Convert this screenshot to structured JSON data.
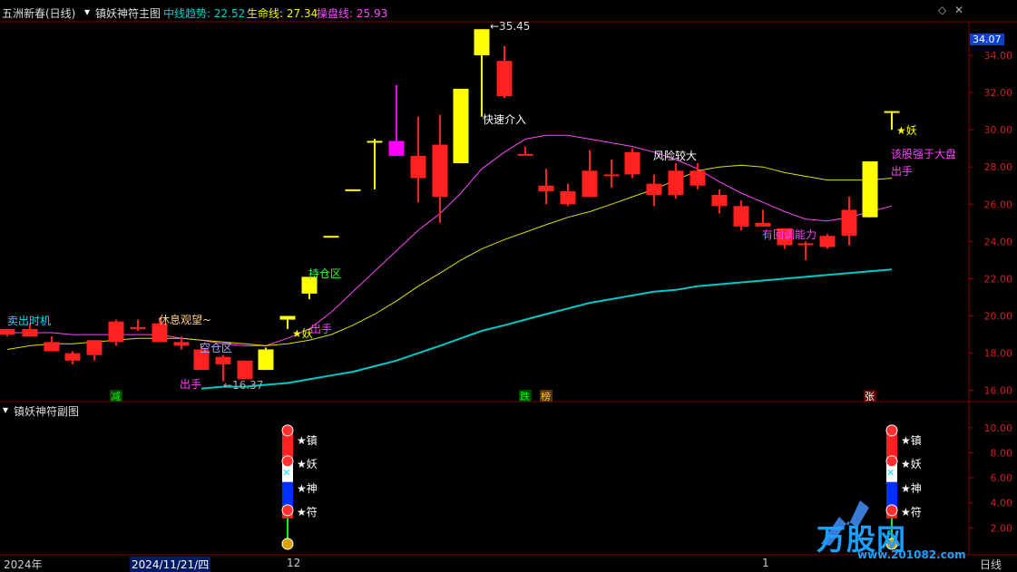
{
  "header": {
    "stock": "五洲新春(日线)",
    "indicator": "镇妖神符主图",
    "items": [
      {
        "label": "中线趋势: ",
        "value": "22.52",
        "color": "#00d0c8"
      },
      {
        "label": "生命线: ",
        "value": "27.34",
        "color": "#f5f500"
      },
      {
        "label": "操盘线: ",
        "value": "25.93",
        "color": "#ff44ff"
      }
    ]
  },
  "sub_panel": {
    "title": "镇妖神符副图"
  },
  "time_axis": {
    "left": "2024年",
    "date": "2024/11/21/四",
    "mid": "12",
    "right": "1",
    "period": "日线"
  },
  "price_flag": "34.07",
  "colors": {
    "up": "#ff2020",
    "down": "#ff2020",
    "yellow": "#ffff00",
    "magenta": "#ff00ff",
    "cyan": "#00c8c8"
  },
  "chart_data": [
    {
      "type": "candlestick",
      "title": "镇妖神符主图",
      "ylim": [
        15.4,
        35.8
      ],
      "yticks": [
        16.0,
        18.0,
        20.0,
        22.0,
        24.0,
        26.0,
        28.0,
        30.0,
        32.0,
        34.0
      ],
      "candles": [
        {
          "o": 19.0,
          "h": 19.3,
          "l": 18.9,
          "c": 19.3,
          "color": "red"
        },
        {
          "o": 19.3,
          "h": 19.6,
          "l": 18.9,
          "c": 18.9,
          "color": "red"
        },
        {
          "o": 18.6,
          "h": 18.9,
          "l": 18.1,
          "c": 18.1,
          "color": "red"
        },
        {
          "o": 18.0,
          "h": 18.1,
          "l": 17.4,
          "c": 17.6,
          "color": "red"
        },
        {
          "o": 17.9,
          "h": 18.7,
          "l": 17.6,
          "c": 18.7,
          "color": "red"
        },
        {
          "o": 18.6,
          "h": 19.8,
          "l": 18.4,
          "c": 19.7,
          "color": "red"
        },
        {
          "o": 19.3,
          "h": 19.8,
          "l": 19.2,
          "c": 19.4,
          "color": "red"
        },
        {
          "o": 18.6,
          "h": 19.9,
          "l": 18.6,
          "c": 19.6,
          "color": "red"
        },
        {
          "o": 18.6,
          "h": 18.9,
          "l": 18.2,
          "c": 18.4,
          "color": "red"
        },
        {
          "o": 18.2,
          "h": 18.4,
          "l": 17.1,
          "c": 17.1,
          "color": "red"
        },
        {
          "o": 17.8,
          "h": 17.9,
          "l": 16.5,
          "c": 17.4,
          "color": "red"
        },
        {
          "o": 17.6,
          "h": 17.6,
          "l": 16.6,
          "c": 16.6,
          "color": "red"
        },
        {
          "o": 17.1,
          "h": 18.3,
          "l": 17.1,
          "c": 18.2,
          "color": "yellow"
        },
        {
          "o": 19.8,
          "h": 20.0,
          "l": 19.3,
          "c": 20.0,
          "color": "yellow"
        },
        {
          "o": 21.2,
          "h": 22.1,
          "l": 20.9,
          "c": 22.1,
          "color": "yellow"
        },
        {
          "o": 24.3,
          "h": 24.3,
          "l": 24.3,
          "c": 24.3,
          "color": "yellow"
        },
        {
          "o": 26.8,
          "h": 26.8,
          "l": 26.8,
          "c": 26.8,
          "color": "yellow"
        },
        {
          "o": 29.4,
          "h": 29.5,
          "l": 26.8,
          "c": 29.4,
          "color": "yellow"
        },
        {
          "o": 28.6,
          "h": 32.4,
          "l": 28.6,
          "c": 29.4,
          "color": "magenta"
        },
        {
          "o": 28.6,
          "h": 30.7,
          "l": 26.1,
          "c": 27.4,
          "color": "red"
        },
        {
          "o": 29.2,
          "h": 30.8,
          "l": 25.0,
          "c": 26.4,
          "color": "red"
        },
        {
          "o": 28.2,
          "h": 32.2,
          "l": 28.2,
          "c": 32.2,
          "color": "yellow"
        },
        {
          "o": 34.0,
          "h": 35.4,
          "l": 30.7,
          "c": 35.4,
          "color": "yellow"
        },
        {
          "o": 33.7,
          "h": 34.5,
          "l": 31.7,
          "c": 31.8,
          "color": "red"
        },
        {
          "o": 28.7,
          "h": 29.1,
          "l": 28.7,
          "c": 28.7,
          "color": "red"
        },
        {
          "o": 27.0,
          "h": 27.9,
          "l": 26.0,
          "c": 26.7,
          "color": "red"
        },
        {
          "o": 26.7,
          "h": 27.1,
          "l": 25.9,
          "c": 26.0,
          "color": "red"
        },
        {
          "o": 26.4,
          "h": 28.9,
          "l": 26.4,
          "c": 27.8,
          "color": "red"
        },
        {
          "o": 27.6,
          "h": 28.4,
          "l": 26.9,
          "c": 27.6,
          "color": "red"
        },
        {
          "o": 27.6,
          "h": 29.0,
          "l": 27.4,
          "c": 28.8,
          "color": "red"
        },
        {
          "o": 27.1,
          "h": 27.6,
          "l": 25.9,
          "c": 26.5,
          "color": "red"
        },
        {
          "o": 27.8,
          "h": 28.2,
          "l": 26.3,
          "c": 26.5,
          "color": "red"
        },
        {
          "o": 27.8,
          "h": 28.2,
          "l": 26.8,
          "c": 27.0,
          "color": "red"
        },
        {
          "o": 26.5,
          "h": 26.8,
          "l": 25.5,
          "c": 25.9,
          "color": "red"
        },
        {
          "o": 25.9,
          "h": 26.2,
          "l": 24.6,
          "c": 24.8,
          "color": "red"
        },
        {
          "o": 25.0,
          "h": 25.7,
          "l": 24.8,
          "c": 24.8,
          "color": "red"
        },
        {
          "o": 24.7,
          "h": 24.7,
          "l": 23.6,
          "c": 23.8,
          "color": "red"
        },
        {
          "o": 23.9,
          "h": 24.0,
          "l": 23.0,
          "c": 23.9,
          "color": "red"
        },
        {
          "o": 24.3,
          "h": 24.4,
          "l": 23.6,
          "c": 23.7,
          "color": "red"
        },
        {
          "o": 25.7,
          "h": 26.4,
          "l": 23.8,
          "c": 24.3,
          "color": "red"
        },
        {
          "o": 25.3,
          "h": 28.3,
          "l": 25.3,
          "c": 28.3,
          "color": "yellow"
        },
        {
          "o": 31.0,
          "h": 31.0,
          "l": 30.0,
          "c": 31.0,
          "color": "yellow"
        }
      ],
      "lines": [
        {
          "name": "操盘线",
          "color": "#ff44ff",
          "values": [
            19.1,
            19.1,
            19.1,
            19.0,
            19.0,
            19.0,
            19.0,
            19.0,
            18.8,
            18.7,
            18.5,
            18.4,
            18.4,
            18.8,
            19.3,
            20.2,
            21.3,
            22.4,
            23.5,
            24.6,
            25.5,
            26.6,
            27.9,
            28.8,
            29.5,
            29.7,
            29.7,
            29.5,
            29.3,
            29.1,
            28.8,
            28.4,
            27.9,
            27.2,
            26.6,
            26.1,
            25.6,
            25.2,
            25.1,
            25.3,
            25.6,
            25.9
          ]
        },
        {
          "name": "生命线",
          "color": "#e0e000",
          "values": [
            18.2,
            18.4,
            18.5,
            18.5,
            18.6,
            18.7,
            18.8,
            18.8,
            18.8,
            18.7,
            18.6,
            18.5,
            18.4,
            18.5,
            18.7,
            19.0,
            19.5,
            20.1,
            20.8,
            21.6,
            22.3,
            23.0,
            23.6,
            24.1,
            24.5,
            24.9,
            25.3,
            25.6,
            26.0,
            26.4,
            26.8,
            27.3,
            27.8,
            28.0,
            28.1,
            28.0,
            27.7,
            27.5,
            27.3,
            27.3,
            27.3,
            27.4
          ]
        },
        {
          "name": "中线趋势",
          "color": "#00c8c8",
          "values": [
            null,
            null,
            null,
            null,
            null,
            null,
            null,
            null,
            null,
            16.1,
            16.2,
            16.2,
            16.3,
            16.4,
            16.6,
            16.8,
            17.0,
            17.3,
            17.6,
            18.0,
            18.4,
            18.8,
            19.2,
            19.5,
            19.8,
            20.1,
            20.4,
            20.7,
            20.9,
            21.1,
            21.3,
            21.4,
            21.6,
            21.7,
            21.8,
            21.9,
            22.0,
            22.1,
            22.2,
            22.3,
            22.4,
            22.5
          ]
        }
      ],
      "annotations": [
        {
          "text": "卖出时机",
          "color": "#00e0ff"
        },
        {
          "text": "休息观望~",
          "color": "#ffd080"
        },
        {
          "text": "空仓区",
          "color": "#aaaaff"
        },
        {
          "text": "出手",
          "color": "#ff44ff"
        },
        {
          "text": "←16.37",
          "color": "#aaaaaa"
        },
        {
          "text": "★妖",
          "color": "#ffff00"
        },
        {
          "text": "出手",
          "color": "#ff44ff"
        },
        {
          "text": "持仓区",
          "color": "#33ff33"
        },
        {
          "text": "←35.45",
          "color": "#dddddd"
        },
        {
          "text": "快速介入",
          "color": "#ffffff"
        },
        {
          "text": "风险较大",
          "color": "#ffffff"
        },
        {
          "text": "有回调能力",
          "color": "#ff44ff"
        },
        {
          "text": "★妖",
          "color": "#ffff00"
        },
        {
          "text": "该股强于大盘",
          "color": "#ff44ff"
        },
        {
          "text": "出手",
          "color": "#ff44ff"
        }
      ],
      "bottom_markers": [
        {
          "text": "减",
          "color": "#00ff00",
          "bg": "#004400"
        },
        {
          "text": "跌",
          "color": "#00ff00",
          "bg": "#004400"
        },
        {
          "text": "榜",
          "color": "#ffcc00",
          "bg": "#553300"
        },
        {
          "text": "张",
          "color": "#ffffff",
          "bg": "#660000"
        }
      ]
    },
    {
      "type": "bar",
      "title": "镇妖神符副图",
      "ylim": [
        0,
        11
      ],
      "yticks": [
        2.0,
        4.0,
        6.0,
        8.0,
        10.0
      ],
      "signals": [
        {
          "labels": [
            "★镇",
            "★妖",
            "★神",
            "★符"
          ],
          "value": 10
        },
        {
          "labels": [
            "★镇",
            "★妖",
            "★神",
            "★符"
          ],
          "value": 10
        }
      ]
    }
  ],
  "watermark": {
    "brand": "万股网",
    "url": "www.201082.com"
  }
}
